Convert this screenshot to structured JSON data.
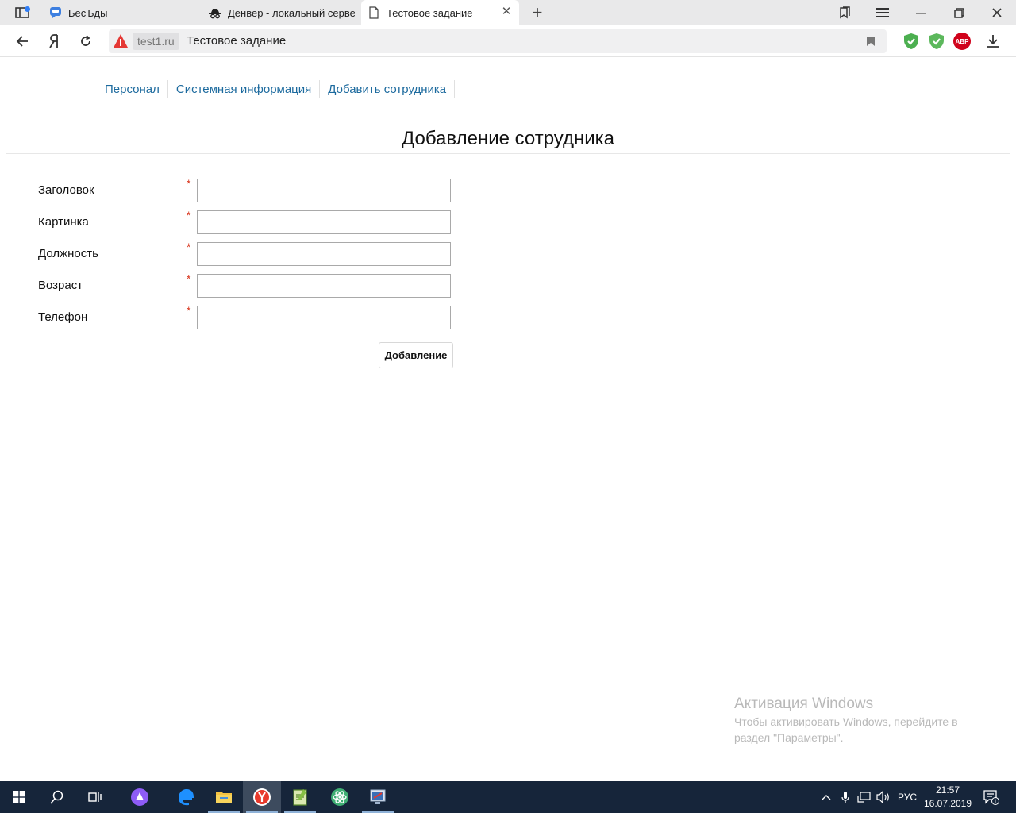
{
  "browser": {
    "tabs": [
      {
        "title": "БесЪды",
        "icon": "chat-icon",
        "active": false
      },
      {
        "title": "Денвер - локальный серве",
        "icon": "spy-hat-icon",
        "active": false
      },
      {
        "title": "Тестовое задание",
        "icon": "document-icon",
        "active": true
      }
    ],
    "address": {
      "domain": "test1.ru",
      "page_title": "Тестовое задание"
    }
  },
  "page": {
    "nav": [
      "Персонал",
      "Системная информация",
      "Добавить сотрудника"
    ],
    "heading": "Добавление сотрудника",
    "required_mark": "*",
    "fields": [
      {
        "label": "Заголовок",
        "value": ""
      },
      {
        "label": "Картинка",
        "value": ""
      },
      {
        "label": "Должность",
        "value": ""
      },
      {
        "label": "Возраст",
        "value": ""
      },
      {
        "label": "Телефон",
        "value": ""
      }
    ],
    "submit_label": "Добавление"
  },
  "activation": {
    "title": "Активация Windows",
    "text": "Чтобы активировать Windows, перейдите в раздел \"Параметры\"."
  },
  "taskbar": {
    "language": "РУС",
    "time": "21:57",
    "date": "16.07.2019",
    "notifications": "1"
  },
  "colors": {
    "link": "#1c6a9e",
    "required": "#d9341b",
    "taskbar": "#16253a",
    "warning": "#e53935"
  }
}
